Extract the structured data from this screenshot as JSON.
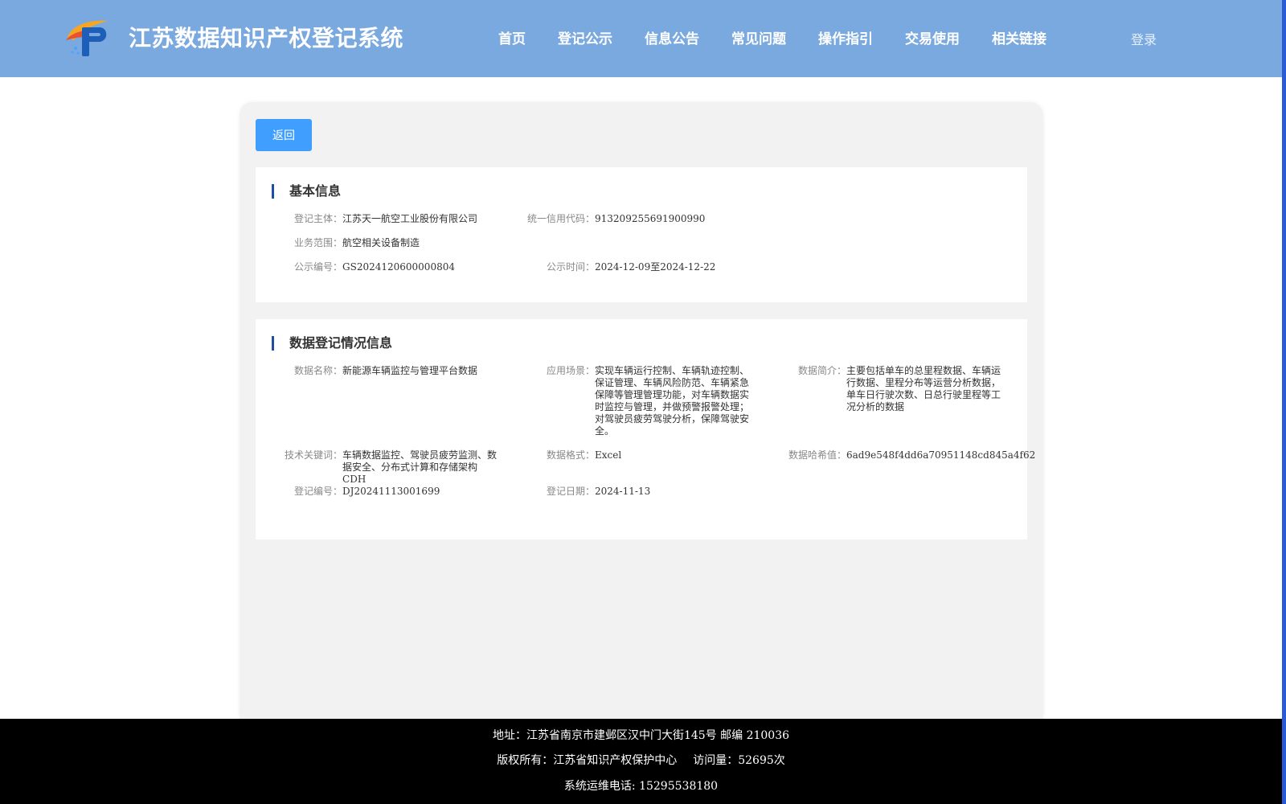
{
  "header": {
    "title": "江苏数据知识产权登记系统",
    "nav": [
      "首页",
      "登记公示",
      "信息公告",
      "常见问题",
      "操作指引",
      "交易使用",
      "相关链接"
    ],
    "login": "登录"
  },
  "main": {
    "back_label": "返回",
    "basic": {
      "title": "基本信息",
      "subject_label": "登记主体：",
      "subject": "江苏天一航空工业股份有限公司",
      "credit_label": "统一信用代码：",
      "credit": "913209255691900990",
      "scope_label": "业务范围：",
      "scope": "航空相关设备制造",
      "notice_no_label": "公示编号：",
      "notice_no": "GS2024120600000804",
      "notice_time_label": "公示时间：",
      "notice_time": "2024-12-09至2024-12-22"
    },
    "registration": {
      "title": "数据登记情况信息",
      "name_label": "数据名称：",
      "name": "新能源车辆监控与管理平台数据",
      "scene_label": "应用场景：",
      "scene": "实现车辆运行控制、车辆轨迹控制、保证管理、车辆风险防范、车辆紧急保障等管理管理功能，对车辆数据实时监控与管理，并做预警报警处理；对驾驶员疲劳驾驶分析，保障驾驶安全。",
      "intro_label": "数据简介：",
      "intro": "主要包括单车的总里程数据、车辆运行数据、里程分布等运营分析数据，单车日行驶次数、日总行驶里程等工况分析的数据",
      "keywords_label": "技术关键词：",
      "keywords": "车辆数据监控、驾驶员疲劳监测、数据安全、分布式计算和存储架构CDH",
      "format_label": "数据格式：",
      "format": "Excel",
      "hash_label": "数据哈希值：",
      "hash": "6ad9e548f4dd6a70951148cd845a4f62",
      "reg_no_label": "登记编号：",
      "reg_no": "DJ20241113001699",
      "reg_date_label": "登记日期：",
      "reg_date": "2024-11-13"
    }
  },
  "footer": {
    "address": "地址：江苏省南京市建邺区汉中门大街145号 邮编 210036",
    "copyright": "版权所有：江苏省知识产权保护中心",
    "visits": "访问量：52695次",
    "phone": "系统运维电话: 15295538180"
  },
  "colors": {
    "header_bg": "#7aa9df",
    "button": "#409eff",
    "title_bar": "#1f4fa3",
    "footer_bg": "#000000"
  },
  "icons": {
    "logo": "ip-logo-icon"
  }
}
